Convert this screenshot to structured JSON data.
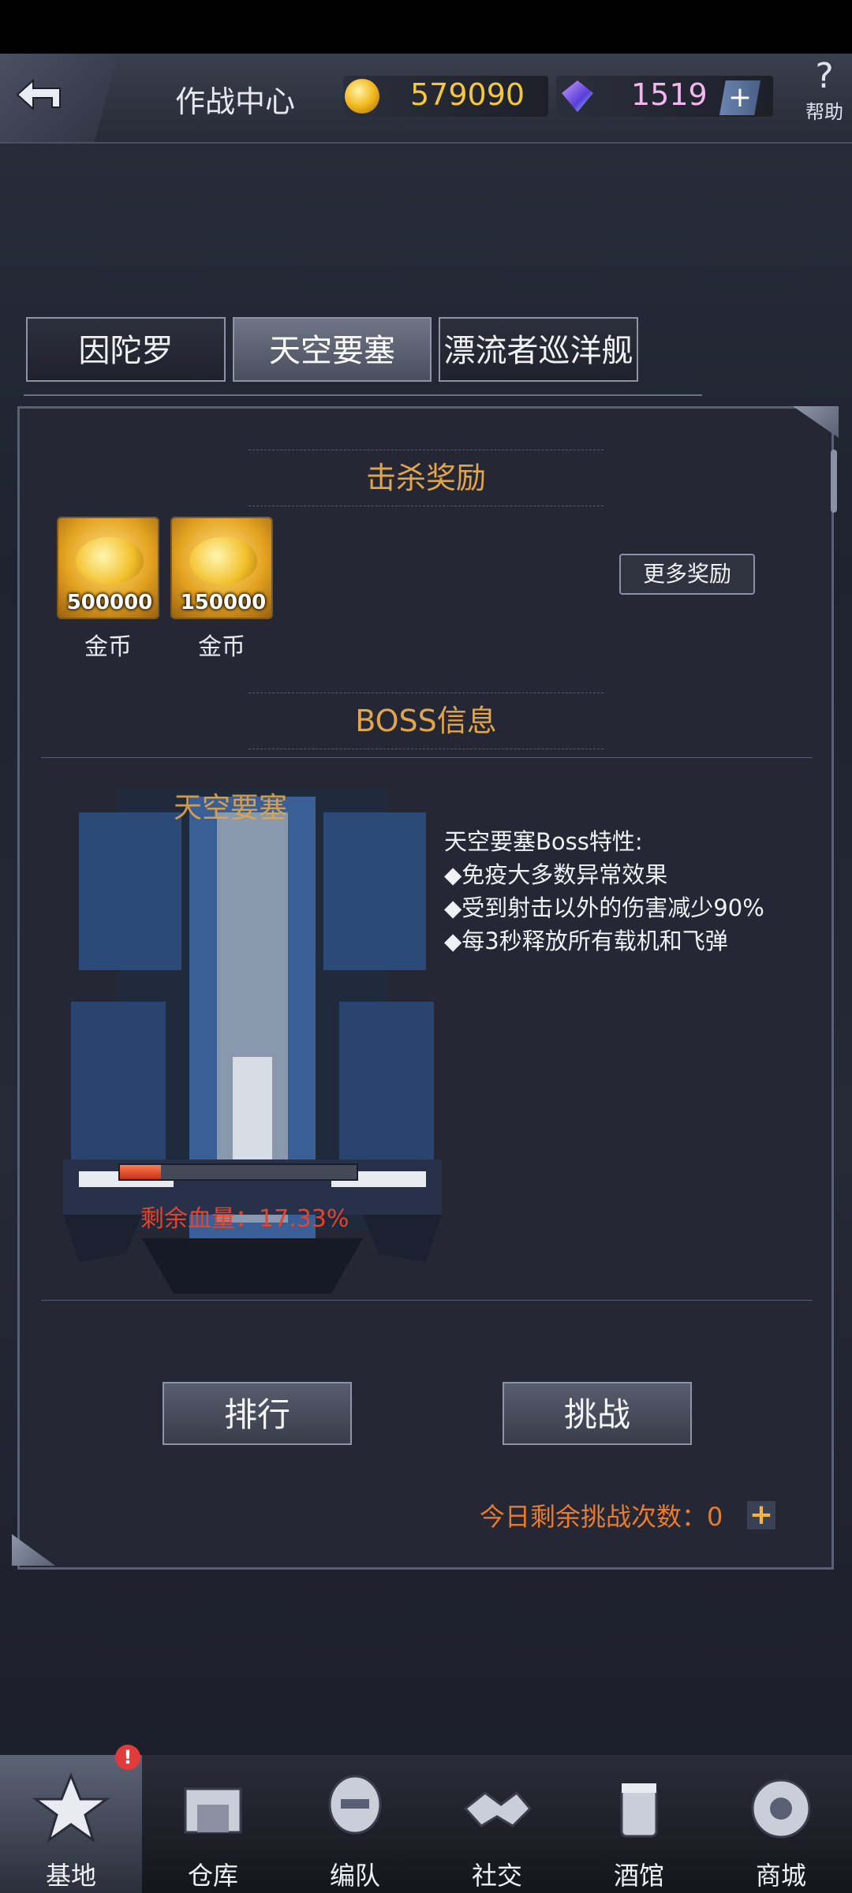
{
  "header": {
    "title": "作战中心",
    "gold": "579090",
    "gems": "1519",
    "plus": "+",
    "help_label": "帮助",
    "help_glyph": "?"
  },
  "tabs": [
    {
      "label": "因陀罗",
      "active": false
    },
    {
      "label": "天空要塞",
      "active": true
    },
    {
      "label": "漂流者巡洋舰",
      "active": false
    }
  ],
  "rewards": {
    "title": "击杀奖励",
    "items": [
      {
        "amount": "500000",
        "name": "金币"
      },
      {
        "amount": "150000",
        "name": "金币"
      }
    ],
    "more_label": "更多奖励"
  },
  "boss": {
    "section_title": "BOSS信息",
    "name": "天空要塞",
    "hp_text": "剩余血量：17.33%",
    "hp_fraction": 0.1733,
    "traits": [
      "天空要塞Boss特性:",
      "◆免疫大多数异常效果",
      "◆受到射击以外的伤害减少90%",
      "◆每3秒释放所有载机和飞弹"
    ]
  },
  "actions": {
    "rank_label": "排行",
    "challenge_label": "挑战",
    "remaining_text": "今日剩余挑战次数：0",
    "remaining_plus": "+"
  },
  "nav": {
    "badge": "!",
    "items": [
      {
        "label": "基地",
        "icon": "base-icon",
        "active": true
      },
      {
        "label": "仓库",
        "icon": "warehouse-icon",
        "active": false
      },
      {
        "label": "编队",
        "icon": "formation-icon",
        "active": false
      },
      {
        "label": "社交",
        "icon": "social-icon",
        "active": false
      },
      {
        "label": "酒馆",
        "icon": "tavern-icon",
        "active": false
      },
      {
        "label": "商城",
        "icon": "shop-icon",
        "active": false
      }
    ]
  },
  "colors": {
    "accent_gold": "#e2a64a",
    "warning_red": "#e5432c",
    "remain_orange": "#ea7b2c"
  }
}
